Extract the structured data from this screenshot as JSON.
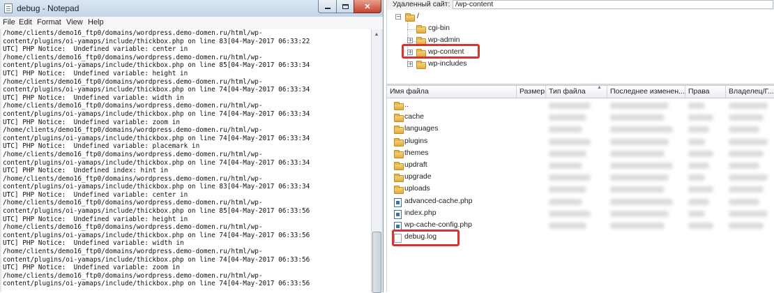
{
  "notepad": {
    "title": "debug - Notepad",
    "menu": [
      "File",
      "Edit",
      "Format",
      "View",
      "Help"
    ],
    "text_lines": [
      "/home/clients/demo16_ftp0/domains/wordpress.demo-domen.ru/html/wp-",
      "content/plugins/oi-yamaps/include/thickbox.php on line 83[04-May-2017 06:33:22",
      "UTC] PHP Notice:  Undefined variable: center in",
      "/home/clients/demo16_ftp0/domains/wordpress.demo-domen.ru/html/wp-",
      "content/plugins/oi-yamaps/include/thickbox.php on line 85[04-May-2017 06:33:34",
      "UTC] PHP Notice:  Undefined variable: height in",
      "/home/clients/demo16_ftp0/domains/wordpress.demo-domen.ru/html/wp-",
      "content/plugins/oi-yamaps/include/thickbox.php on line 74[04-May-2017 06:33:34",
      "UTC] PHP Notice:  Undefined variable: width in",
      "/home/clients/demo16_ftp0/domains/wordpress.demo-domen.ru/html/wp-",
      "content/plugins/oi-yamaps/include/thickbox.php on line 74[04-May-2017 06:33:34",
      "UTC] PHP Notice:  Undefined variable: zoom in",
      "/home/clients/demo16_ftp0/domains/wordpress.demo-domen.ru/html/wp-",
      "content/plugins/oi-yamaps/include/thickbox.php on line 74[04-May-2017 06:33:34",
      "UTC] PHP Notice:  Undefined variable: placemark in",
      "/home/clients/demo16_ftp0/domains/wordpress.demo-domen.ru/html/wp-",
      "content/plugins/oi-yamaps/include/thickbox.php on line 74[04-May-2017 06:33:34",
      "UTC] PHP Notice:  Undefined index: hint in",
      "/home/clients/demo16_ftp0/domains/wordpress.demo-domen.ru/html/wp-",
      "content/plugins/oi-yamaps/include/thickbox.php on line 83[04-May-2017 06:33:34",
      "UTC] PHP Notice:  Undefined variable: center in",
      "/home/clients/demo16_ftp0/domains/wordpress.demo-domen.ru/html/wp-",
      "content/plugins/oi-yamaps/include/thickbox.php on line 85[04-May-2017 06:33:56",
      "UTC] PHP Notice:  Undefined variable: height in",
      "/home/clients/demo16_ftp0/domains/wordpress.demo-domen.ru/html/wp-",
      "content/plugins/oi-yamaps/include/thickbox.php on line 74[04-May-2017 06:33:56",
      "UTC] PHP Notice:  Undefined variable: width in",
      "/home/clients/demo16_ftp0/domains/wordpress.demo-domen.ru/html/wp-",
      "content/plugins/oi-yamaps/include/thickbox.php on line 74[04-May-2017 06:33:56",
      "UTC] PHP Notice:  Undefined variable: zoom in",
      "/home/clients/demo16_ftp0/domains/wordpress.demo-domen.ru/html/wp-",
      "content/plugins/oi-yamaps/include/thickbox.php on line 74[04-May-2017 06:33:56"
    ]
  },
  "remote": {
    "site_label": "Удаленный сайт:",
    "path": "/wp-content",
    "tree": {
      "root": "/",
      "children": [
        "cgi-bin",
        "wp-admin",
        "wp-content",
        "wp-includes"
      ]
    },
    "columns": [
      "Имя файла",
      "Размер",
      "Тип файла",
      "Последнее изменен...",
      "Права",
      "Владелец/Г..."
    ],
    "files": [
      {
        "name": "..",
        "kind": "folder"
      },
      {
        "name": "cache",
        "kind": "folder"
      },
      {
        "name": "languages",
        "kind": "folder"
      },
      {
        "name": "plugins",
        "kind": "folder"
      },
      {
        "name": "themes",
        "kind": "folder"
      },
      {
        "name": "updraft",
        "kind": "folder"
      },
      {
        "name": "upgrade",
        "kind": "folder"
      },
      {
        "name": "uploads",
        "kind": "folder"
      },
      {
        "name": "advanced-cache.php",
        "kind": "php"
      },
      {
        "name": "index.php",
        "kind": "php"
      },
      {
        "name": "wp-cache-config.php",
        "kind": "php"
      },
      {
        "name": "debug.log",
        "kind": "log"
      }
    ]
  },
  "colors": {
    "highlight": "#d63333",
    "folder": "#e8b64c",
    "php_file": "#3d6fa8"
  },
  "icons": [
    "notepad-icon",
    "minimize-icon",
    "maximize-icon",
    "close-icon",
    "folder-icon",
    "php-file-icon",
    "log-file-icon",
    "expand-icon"
  ]
}
